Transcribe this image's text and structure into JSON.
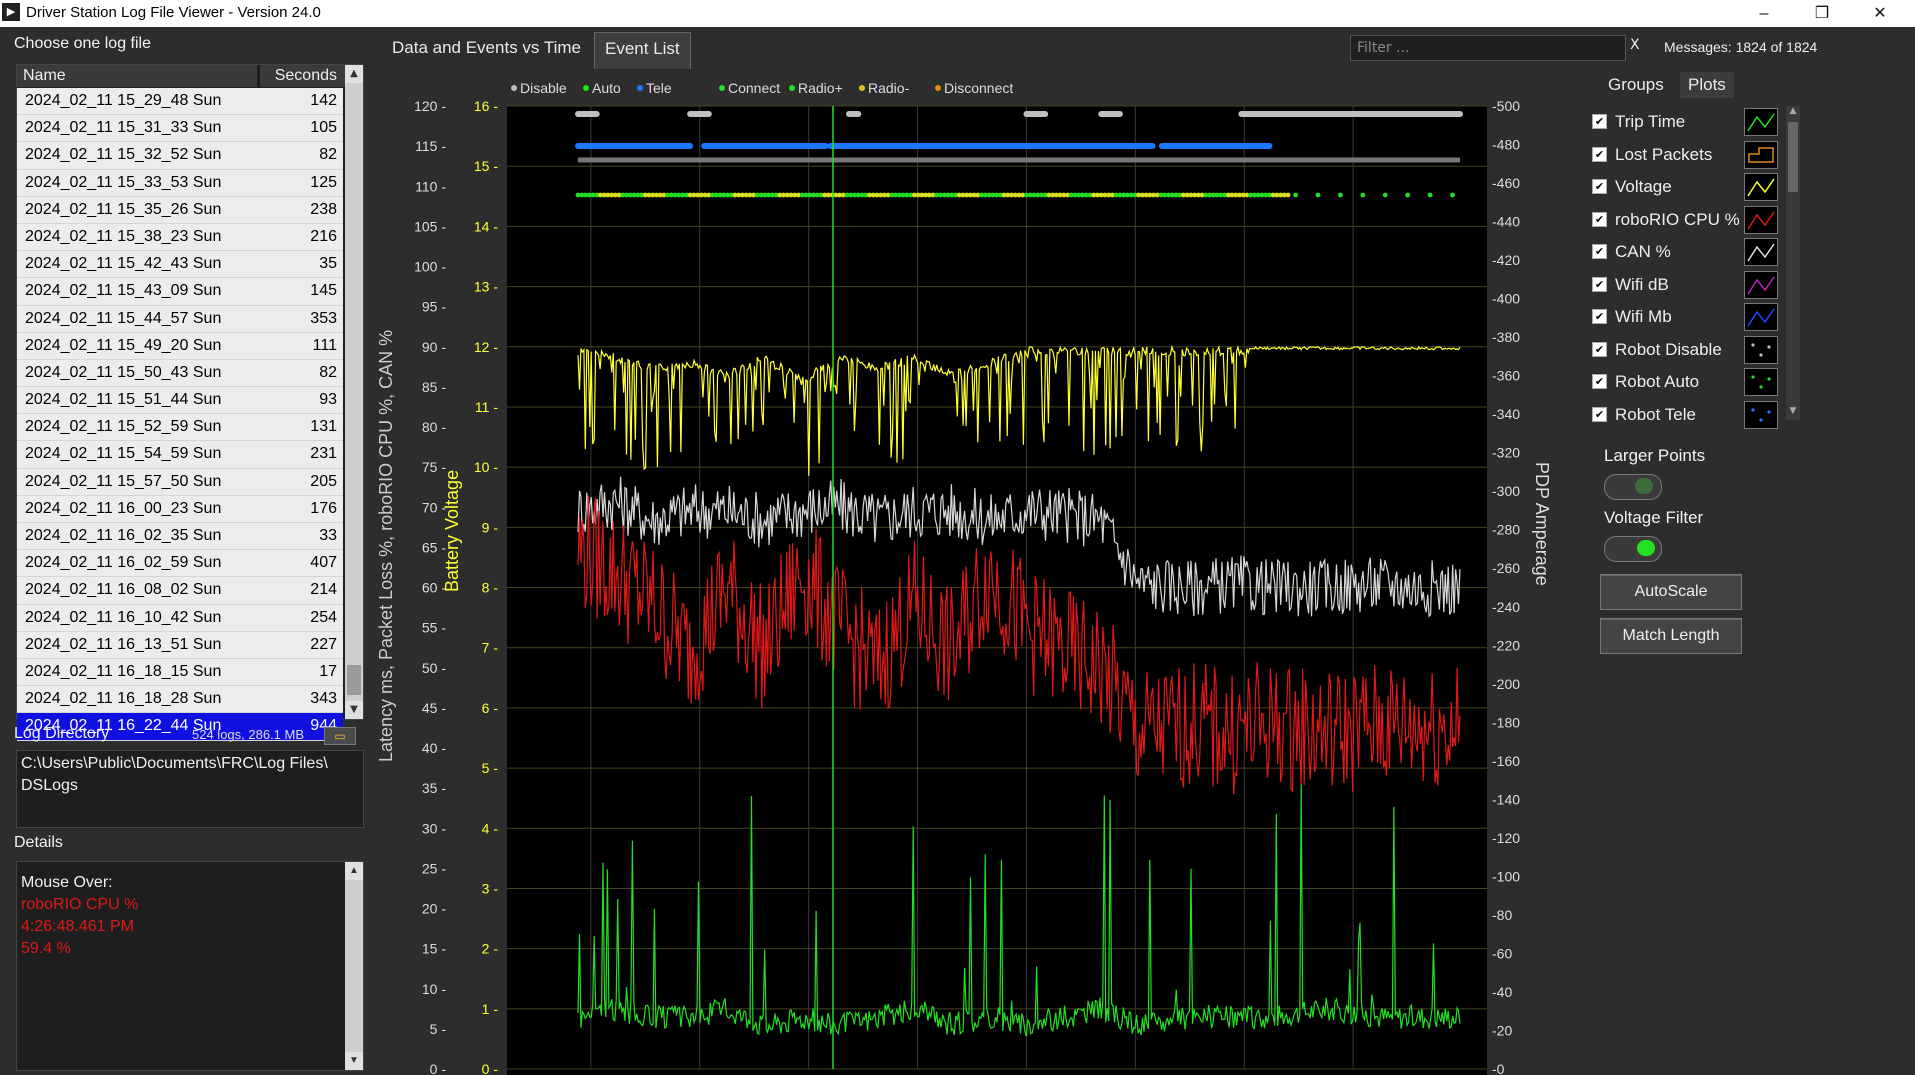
{
  "window": {
    "title": "Driver Station Log File Viewer - Version 24.0"
  },
  "left": {
    "choose_label": "Choose one log file",
    "columns": {
      "name": "Name",
      "seconds": "Seconds"
    },
    "logs": [
      {
        "name": "2024_02_11 15_29_48 Sun",
        "seconds": "142"
      },
      {
        "name": "2024_02_11 15_31_33 Sun",
        "seconds": "105"
      },
      {
        "name": "2024_02_11 15_32_52 Sun",
        "seconds": "82"
      },
      {
        "name": "2024_02_11 15_33_53 Sun",
        "seconds": "125"
      },
      {
        "name": "2024_02_11 15_35_26 Sun",
        "seconds": "238"
      },
      {
        "name": "2024_02_11 15_38_23 Sun",
        "seconds": "216"
      },
      {
        "name": "2024_02_11 15_42_43 Sun",
        "seconds": "35"
      },
      {
        "name": "2024_02_11 15_43_09 Sun",
        "seconds": "145"
      },
      {
        "name": "2024_02_11 15_44_57 Sun",
        "seconds": "353"
      },
      {
        "name": "2024_02_11 15_49_20 Sun",
        "seconds": "111"
      },
      {
        "name": "2024_02_11 15_50_43 Sun",
        "seconds": "82"
      },
      {
        "name": "2024_02_11 15_51_44 Sun",
        "seconds": "93"
      },
      {
        "name": "2024_02_11 15_52_59 Sun",
        "seconds": "131"
      },
      {
        "name": "2024_02_11 15_54_59 Sun",
        "seconds": "231"
      },
      {
        "name": "2024_02_11 15_57_50 Sun",
        "seconds": "205"
      },
      {
        "name": "2024_02_11 16_00_23 Sun",
        "seconds": "176"
      },
      {
        "name": "2024_02_11 16_02_35 Sun",
        "seconds": "33"
      },
      {
        "name": "2024_02_11 16_02_59 Sun",
        "seconds": "407"
      },
      {
        "name": "2024_02_11 16_08_02 Sun",
        "seconds": "214"
      },
      {
        "name": "2024_02_11 16_10_42 Sun",
        "seconds": "254"
      },
      {
        "name": "2024_02_11 16_13_51 Sun",
        "seconds": "227"
      },
      {
        "name": "2024_02_11 16_18_15 Sun",
        "seconds": "17"
      },
      {
        "name": "2024_02_11 16_18_28 Sun",
        "seconds": "343"
      },
      {
        "name": "2024_02_11 16_22_44 Sun",
        "seconds": "944"
      }
    ],
    "selected_index": 23,
    "log_directory_label": "Log Directory",
    "log_stats": "524 logs, 286.1 MB",
    "directory_path_line1": "C:\\Users\\Public\\Documents\\FRC\\Log Files\\",
    "directory_path_line2": "DSLogs",
    "details_label": "Details",
    "details": {
      "heading": "Mouse Over:",
      "series": "roboRIO CPU %",
      "time": "4:26:48.461 PM",
      "value": "59.4 %"
    }
  },
  "tabs": [
    {
      "label": "Data and Events vs Time"
    },
    {
      "label": "Event List"
    }
  ],
  "filter": {
    "placeholder": "Filter ...",
    "clear_label": "X"
  },
  "messages": "Messages: 1824 of 1824",
  "chart_data": {
    "type": "line",
    "legend_top": [
      "Disable",
      "Auto",
      "Tele",
      "Connect",
      "Radio+",
      "Radio-",
      "Disconnect"
    ],
    "axes": {
      "left_outer": {
        "label": "Latency ms, Packet Loss %, roboRIO CPU %, CAN %",
        "min": 0,
        "max": 120,
        "ticks": [
          "0",
          "5",
          "10",
          "15",
          "20",
          "25",
          "30",
          "35",
          "40",
          "45",
          "50",
          "55",
          "60",
          "65",
          "70",
          "75",
          "80",
          "85",
          "90",
          "95",
          "100",
          "105",
          "110",
          "115",
          "120"
        ]
      },
      "left_inner": {
        "label": "Battery Voltage",
        "min": 0,
        "max": 16,
        "ticks": [
          "0",
          "1",
          "2",
          "3",
          "4",
          "5",
          "6",
          "7",
          "8",
          "9",
          "10",
          "11",
          "12",
          "13",
          "14",
          "15",
          "16"
        ]
      },
      "right": {
        "label": "PDP Amperage",
        "min": 0,
        "max": 500,
        "ticks": [
          "0",
          "20",
          "40",
          "60",
          "80",
          "100",
          "120",
          "140",
          "160",
          "180",
          "200",
          "220",
          "240",
          "260",
          "280",
          "300",
          "320",
          "340",
          "360",
          "380",
          "400",
          "420",
          "440",
          "460",
          "480",
          "500"
        ]
      }
    },
    "time_range_s": [
      0,
      944
    ],
    "series": [
      {
        "name": "Voltage",
        "color": "#ffff33",
        "axis": "left_inner",
        "x": [
          0,
          40,
          80,
          120,
          160,
          200,
          240,
          280,
          320,
          360,
          400,
          440,
          480,
          520,
          560,
          600,
          660,
          700,
          740,
          800,
          860,
          900,
          944
        ],
        "y": [
          12.0,
          11.9,
          11.7,
          11.8,
          11.6,
          11.9,
          11.5,
          11.9,
          11.7,
          11.9,
          11.6,
          11.8,
          12.0,
          12.0,
          12.0,
          12.0,
          12.0,
          12.0,
          12.0,
          12.0,
          12.0,
          12.0,
          12.0
        ]
      },
      {
        "name": "PDP Amperage",
        "color": "#d8d8d8",
        "axis": "right",
        "x": [
          0,
          40,
          80,
          120,
          160,
          200,
          240,
          280,
          320,
          360,
          400,
          440,
          480,
          520,
          560,
          600,
          660,
          700,
          740,
          800,
          860,
          900,
          944
        ],
        "y": [
          290,
          295,
          285,
          290,
          290,
          285,
          290,
          292,
          285,
          290,
          290,
          285,
          290,
          288,
          285,
          252,
          250,
          252,
          250,
          250,
          252,
          250,
          250
        ]
      },
      {
        "name": "roboRIO CPU %",
        "color": "#e01818",
        "axis": "left_outer",
        "x": [
          0,
          40,
          80,
          120,
          160,
          200,
          240,
          280,
          320,
          360,
          400,
          440,
          480,
          520,
          560,
          600,
          660,
          700,
          740,
          800,
          860,
          900,
          944
        ],
        "y": [
          65,
          62,
          58,
          52,
          60,
          52,
          62,
          55,
          50,
          58,
          52,
          62,
          55,
          52,
          50,
          42,
          43,
          42,
          43,
          42,
          43,
          43,
          43
        ]
      },
      {
        "name": "Latency ms",
        "color": "#22e022",
        "axis": "left_outer",
        "x": [
          0,
          40,
          80,
          120,
          160,
          200,
          240,
          280,
          320,
          360,
          400,
          440,
          480,
          520,
          560,
          600,
          660,
          700,
          740,
          800,
          860,
          900,
          944
        ],
        "y": [
          5,
          6,
          5,
          5,
          6,
          4,
          5,
          4,
          5,
          6,
          4,
          5,
          4,
          5,
          6,
          4,
          5,
          5,
          5,
          6,
          5,
          5,
          5
        ]
      }
    ],
    "event_rows": [
      {
        "name": "Disable",
        "color": "#bfbfbf"
      },
      {
        "name": "Tele",
        "color": "#1e78ff"
      },
      {
        "name": "Auto / Comms",
        "color": "#22dd22"
      }
    ],
    "grid": true
  },
  "right": {
    "tab_groups": "Groups",
    "tab_plots": "Plots",
    "plots": [
      {
        "label": "Trip Time",
        "color": "#22e022",
        "checked": true,
        "icon": "line-icon"
      },
      {
        "label": "Lost Packets",
        "color": "#e08a18",
        "checked": true,
        "icon": "step-icon"
      },
      {
        "label": "Voltage",
        "color": "#ffff33",
        "checked": true,
        "icon": "line-icon"
      },
      {
        "label": "roboRIO CPU %",
        "color": "#e01818",
        "checked": true,
        "icon": "line-icon"
      },
      {
        "label": "CAN %",
        "color": "#dddddd",
        "checked": true,
        "icon": "line-icon"
      },
      {
        "label": "Wifi dB",
        "color": "#c020c0",
        "checked": true,
        "icon": "line-icon"
      },
      {
        "label": "Wifi Mb",
        "color": "#2244ff",
        "checked": true,
        "icon": "line-icon"
      },
      {
        "label": "Robot Disable",
        "color": "#bbbbbb",
        "checked": true,
        "icon": "dots-icon"
      },
      {
        "label": "Robot Auto",
        "color": "#22e022",
        "checked": true,
        "icon": "dots-icon"
      },
      {
        "label": "Robot Tele",
        "color": "#2277ff",
        "checked": true,
        "icon": "dots-icon"
      }
    ],
    "larger_points_label": "Larger Points",
    "voltage_filter_label": "Voltage Filter",
    "autoscale_label": "AutoScale",
    "match_length_label": "Match Length"
  }
}
